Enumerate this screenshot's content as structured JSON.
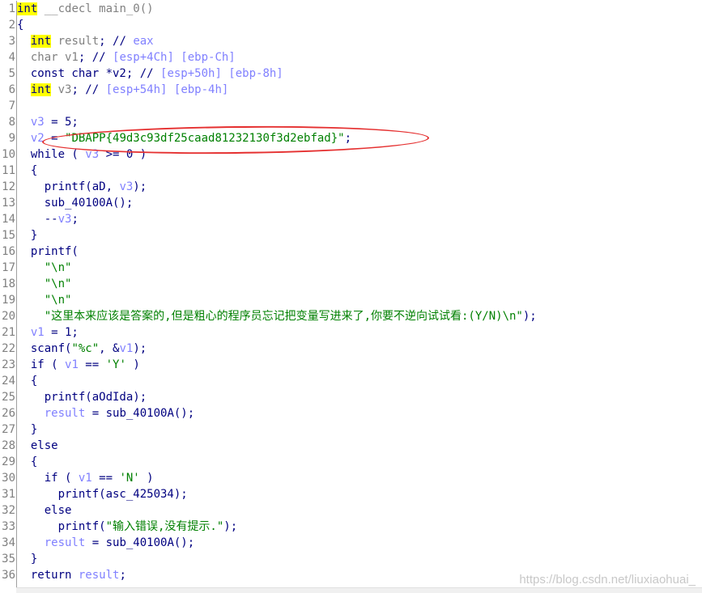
{
  "code_lines": [
    [
      [
        "hl",
        "int"
      ],
      [
        "gr",
        " __cdecl main_0()"
      ]
    ],
    [
      [
        "kw",
        "{"
      ]
    ],
    [
      [
        "kw",
        "  "
      ],
      [
        "hl",
        "int"
      ],
      [
        "gr",
        " result"
      ],
      [
        "kw",
        "; // "
      ],
      [
        "cm",
        "eax"
      ]
    ],
    [
      [
        "gr",
        "  char v1"
      ],
      [
        "kw",
        "; // "
      ],
      [
        "cm",
        "[esp+4Ch] [ebp-Ch]"
      ]
    ],
    [
      [
        "kw",
        "  const char *v2; // "
      ],
      [
        "cm",
        "[esp+50h] [ebp-8h]"
      ]
    ],
    [
      [
        "kw",
        "  "
      ],
      [
        "hl",
        "int"
      ],
      [
        "gr",
        " v3"
      ],
      [
        "kw",
        "; // "
      ],
      [
        "cm",
        "[esp+54h] [ebp-4h]"
      ]
    ],
    [],
    [
      [
        "var",
        "  v3"
      ],
      [
        "kw",
        " = 5;"
      ]
    ],
    [
      [
        "var",
        "  v2"
      ],
      [
        "kw",
        " = "
      ],
      [
        "str",
        "\"DBAPP{49d3c93df25caad81232130f3d2ebfad}\""
      ],
      [
        "kw",
        ";"
      ]
    ],
    [
      [
        "kw",
        "  while ( "
      ],
      [
        "var",
        "v3"
      ],
      [
        "kw",
        " >= 0 )"
      ]
    ],
    [
      [
        "kw",
        "  {"
      ]
    ],
    [
      [
        "kw",
        "    printf(aD, "
      ],
      [
        "var",
        "v3"
      ],
      [
        "kw",
        ");"
      ]
    ],
    [
      [
        "kw",
        "    sub_40100A();"
      ]
    ],
    [
      [
        "kw",
        "    --"
      ],
      [
        "var",
        "v3"
      ],
      [
        "kw",
        ";"
      ]
    ],
    [
      [
        "kw",
        "  }"
      ]
    ],
    [
      [
        "kw",
        "  printf("
      ]
    ],
    [
      [
        "kw",
        "    "
      ],
      [
        "str",
        "\"\\n\""
      ]
    ],
    [
      [
        "kw",
        "    "
      ],
      [
        "str",
        "\"\\n\""
      ]
    ],
    [
      [
        "kw",
        "    "
      ],
      [
        "str",
        "\"\\n\""
      ]
    ],
    [
      [
        "kw",
        "    "
      ],
      [
        "str",
        "\"这里本来应该是答案的,但是粗心的程序员忘记把变量写进来了,你要不逆向试试看:(Y/N)\\n\""
      ],
      [
        "kw",
        ");"
      ]
    ],
    [
      [
        "var",
        "  v1"
      ],
      [
        "kw",
        " = 1;"
      ]
    ],
    [
      [
        "kw",
        "  scanf("
      ],
      [
        "str",
        "\"%c\""
      ],
      [
        "kw",
        ", &"
      ],
      [
        "var",
        "v1"
      ],
      [
        "kw",
        ");"
      ]
    ],
    [
      [
        "kw",
        "  if ( "
      ],
      [
        "var",
        "v1"
      ],
      [
        "kw",
        " == "
      ],
      [
        "str",
        "'Y'"
      ],
      [
        "kw",
        " )"
      ]
    ],
    [
      [
        "kw",
        "  {"
      ]
    ],
    [
      [
        "kw",
        "    printf(aOdIda);"
      ]
    ],
    [
      [
        "var",
        "    result"
      ],
      [
        "kw",
        " = sub_40100A();"
      ]
    ],
    [
      [
        "kw",
        "  }"
      ]
    ],
    [
      [
        "kw",
        "  else"
      ]
    ],
    [
      [
        "kw",
        "  {"
      ]
    ],
    [
      [
        "kw",
        "    if ( "
      ],
      [
        "var",
        "v1"
      ],
      [
        "kw",
        " == "
      ],
      [
        "str",
        "'N'"
      ],
      [
        "kw",
        " )"
      ]
    ],
    [
      [
        "kw",
        "      printf(asc_425034);"
      ]
    ],
    [
      [
        "kw",
        "    else"
      ]
    ],
    [
      [
        "kw",
        "      printf("
      ],
      [
        "str",
        "\"输入错误,没有提示.\""
      ],
      [
        "kw",
        ");"
      ]
    ],
    [
      [
        "var",
        "    result"
      ],
      [
        "kw",
        " = sub_40100A();"
      ]
    ],
    [
      [
        "kw",
        "  }"
      ]
    ],
    [
      [
        "kw",
        "  return "
      ],
      [
        "var",
        "result"
      ],
      [
        "kw",
        ";"
      ]
    ]
  ],
  "watermark": "https://blog.csdn.net/liuxiaohuai_",
  "colors": {
    "keyword": "#000080",
    "variable": "#8080ff",
    "string": "#008000",
    "highlight": "#ffff00",
    "annotation": "#e53030"
  }
}
